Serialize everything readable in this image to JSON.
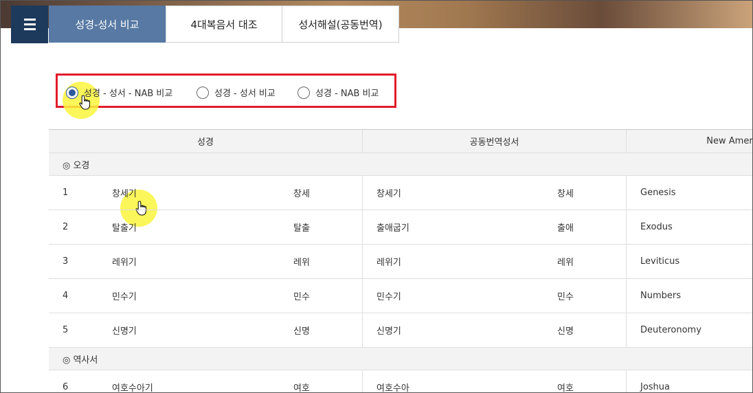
{
  "tabs": [
    {
      "label": "성경-성서 비교",
      "active": true
    },
    {
      "label": "4대복음서 대조",
      "active": false
    },
    {
      "label": "성서해설(공동번역)",
      "active": false
    }
  ],
  "compare_options": [
    {
      "label": "성경 - 성서 - NAB 비교",
      "checked": true
    },
    {
      "label": "성경 - 성서 비교",
      "checked": false
    },
    {
      "label": "성경 - NAB 비교",
      "checked": false
    }
  ],
  "table": {
    "headers": [
      "성경",
      "공동번역성서",
      "New Amer"
    ],
    "sections": [
      {
        "title": "◎ 오경",
        "rows": [
          {
            "no": "1",
            "seong": "창세기",
            "seong_abbr": "창세",
            "gongdong": "창세기",
            "gongdong_abbr": "창세",
            "nab": "Genesis"
          },
          {
            "no": "2",
            "seong": "탈출기",
            "seong_abbr": "탈출",
            "gongdong": "출애굽기",
            "gongdong_abbr": "출애",
            "nab": "Exodus"
          },
          {
            "no": "3",
            "seong": "레위기",
            "seong_abbr": "레위",
            "gongdong": "레위기",
            "gongdong_abbr": "레위",
            "nab": "Leviticus"
          },
          {
            "no": "4",
            "seong": "민수기",
            "seong_abbr": "민수",
            "gongdong": "민수기",
            "gongdong_abbr": "민수",
            "nab": "Numbers"
          },
          {
            "no": "5",
            "seong": "신명기",
            "seong_abbr": "신명",
            "gongdong": "신명기",
            "gongdong_abbr": "신명",
            "nab": "Deuteronomy"
          }
        ]
      },
      {
        "title": "◎ 역사서",
        "rows": [
          {
            "no": "6",
            "seong": "여호수아기",
            "seong_abbr": "여호",
            "gongdong": "여호수아",
            "gongdong_abbr": "여호",
            "nab": "Joshua"
          }
        ]
      }
    ]
  },
  "colors": {
    "active_tab": "#5779a3",
    "menu_button": "#1d3a5c",
    "option_box_border": "#e11b2a",
    "radio_checked": "#2c5a9c",
    "cursor_highlight": "#faf53c"
  },
  "icons": {
    "menu": "hamburger-menu-icon",
    "cursor": "hand-pointer-icon"
  }
}
